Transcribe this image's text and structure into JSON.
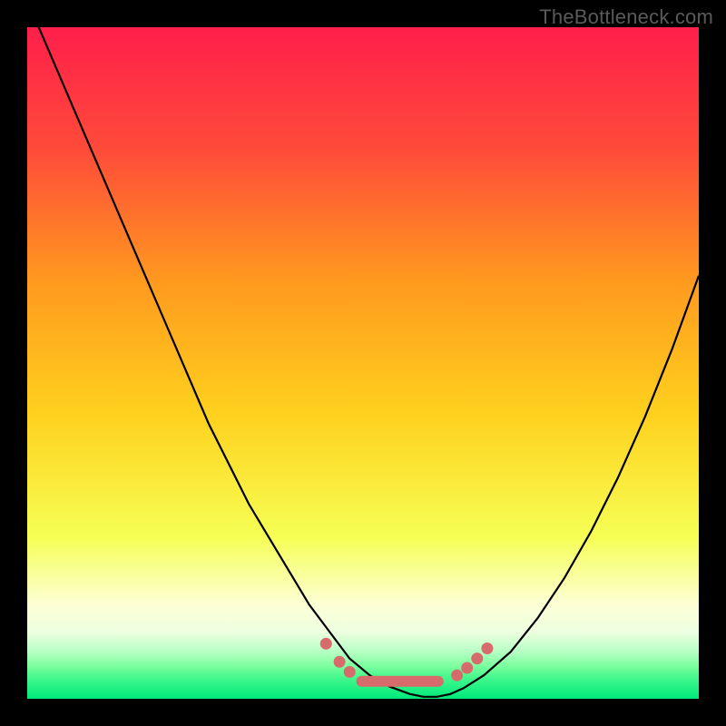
{
  "attribution": "TheBottleneck.com",
  "colors": {
    "frame": "#000000",
    "gradient_top": "#ff1f4b",
    "gradient_mid_upper": "#ff6a2a",
    "gradient_mid": "#ffd21e",
    "gradient_lower": "#f6ff55",
    "gradient_pale": "#fcffd6",
    "gradient_green1": "#7fffa0",
    "gradient_green2": "#00e97a",
    "curve_stroke": "#000000",
    "marker_fill": "#d76a6a"
  },
  "chart_data": {
    "type": "line",
    "title": "",
    "xlabel": "",
    "ylabel": "",
    "xlim": [
      0,
      100
    ],
    "ylim": [
      0,
      100
    ],
    "grid": false,
    "legend": null,
    "series": [
      {
        "name": "bottleneck-curve",
        "x": [
          0,
          3,
          6,
          9,
          12,
          15,
          18,
          21,
          24,
          27,
          30,
          33,
          36,
          39,
          42,
          45,
          48,
          51,
          54,
          57,
          59,
          61,
          63,
          65,
          68,
          72,
          76,
          80,
          84,
          88,
          92,
          96,
          100
        ],
        "y": [
          104,
          97,
          90,
          83,
          76,
          69,
          62,
          55,
          48,
          41,
          35,
          29,
          24,
          19,
          14,
          10,
          6,
          3.5,
          1.8,
          0.7,
          0.3,
          0.3,
          0.7,
          1.6,
          3.5,
          7,
          12,
          18,
          25,
          33,
          42,
          52,
          63
        ]
      }
    ],
    "markers": [
      {
        "x": 44.5,
        "y": 8.2
      },
      {
        "x": 46.5,
        "y": 5.5
      },
      {
        "x": 48.0,
        "y": 4.0
      },
      {
        "x": 64.0,
        "y": 3.5
      },
      {
        "x": 65.5,
        "y": 4.6
      },
      {
        "x": 67.0,
        "y": 6.0
      },
      {
        "x": 68.5,
        "y": 7.5
      }
    ],
    "flat_segment": {
      "x_start": 49,
      "x_end": 62,
      "y": 2.6
    }
  }
}
